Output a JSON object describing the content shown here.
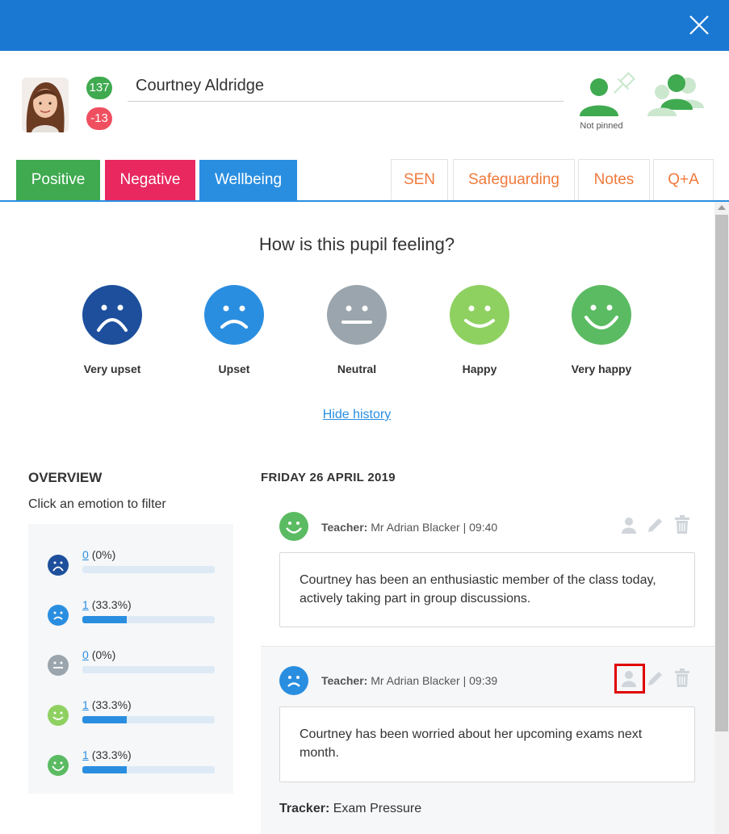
{
  "pupil": {
    "name": "Courtney Aldridge",
    "positive_points": "137",
    "negative_points": "-13",
    "pin_status": "Not pinned"
  },
  "tabs": [
    {
      "label": "Positive",
      "color": "#3faa50"
    },
    {
      "label": "Negative",
      "color": "#e8285f"
    },
    {
      "label": "Wellbeing",
      "color": "#2a8ee0"
    },
    {
      "label": "SEN"
    },
    {
      "label": "Safeguarding"
    },
    {
      "label": "Notes"
    },
    {
      "label": "Q+A"
    }
  ],
  "wellbeing": {
    "question": "How is this pupil feeling?",
    "emotions": [
      {
        "label": "Very upset",
        "color": "#1d4f9c",
        "icon": "very-upset-face-icon"
      },
      {
        "label": "Upset",
        "color": "#2a8ee0",
        "icon": "upset-face-icon"
      },
      {
        "label": "Neutral",
        "color": "#9aa5ad",
        "icon": "neutral-face-icon"
      },
      {
        "label": "Happy",
        "color": "#8ed161",
        "icon": "happy-face-icon"
      },
      {
        "label": "Very happy",
        "color": "#5bbb62",
        "icon": "very-happy-face-icon"
      }
    ],
    "history_toggle": "Hide history"
  },
  "overview": {
    "title": "OVERVIEW",
    "subtitle": "Click an emotion to filter",
    "rows": [
      {
        "count": "0",
        "percent": "(0%)",
        "fraction": 0
      },
      {
        "count": "1",
        "percent": "(33.3%)",
        "fraction": 0.333
      },
      {
        "count": "0",
        "percent": "(0%)",
        "fraction": 0
      },
      {
        "count": "1",
        "percent": "(33.3%)",
        "fraction": 0.333
      },
      {
        "count": "1",
        "percent": "(33.3%)",
        "fraction": 0.333
      }
    ]
  },
  "history": {
    "date": "FRIDAY 26 APRIL 2019",
    "entries": [
      {
        "teacher_label": "Teacher:",
        "teacher_info": "Mr Adrian Blacker | 09:40",
        "text": "Courtney has been an enthusiastic member of the class today, actively taking part in group discussions."
      },
      {
        "teacher_label": "Teacher:",
        "teacher_info": "Mr Adrian Blacker | 09:39",
        "text": "Courtney has been worried about her upcoming exams next month.",
        "tracker_label": "Tracker:",
        "tracker_value": "Exam Pressure"
      }
    ]
  }
}
